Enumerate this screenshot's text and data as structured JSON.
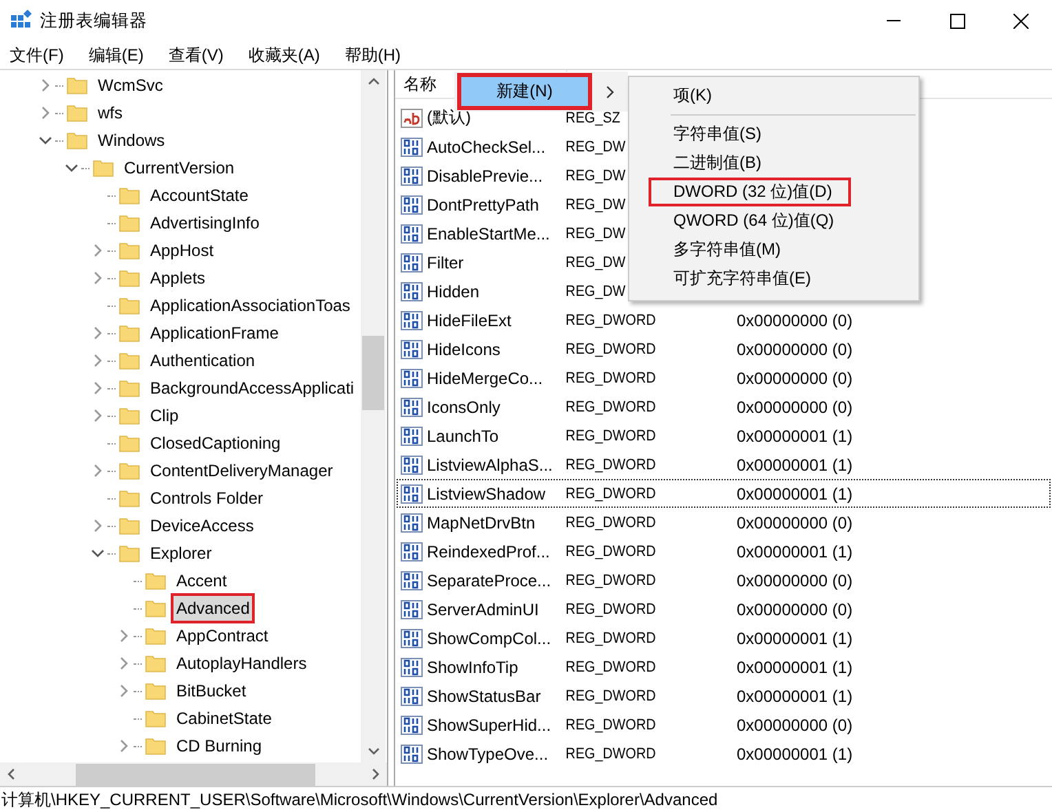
{
  "window": {
    "title": "注册表编辑器"
  },
  "menu_bar": [
    "文件(F)",
    "编辑(E)",
    "查看(V)",
    "收藏夹(A)",
    "帮助(H)"
  ],
  "tree": [
    {
      "label": "WcmSvc",
      "kind": "collapsed",
      "selected": false,
      "highlighted": false
    },
    {
      "label": "wfs",
      "kind": "collapsed",
      "selected": false,
      "highlighted": false
    },
    {
      "label": "Windows",
      "kind": "expanded",
      "selected": false,
      "highlighted": false,
      "children": [
        {
          "label": "CurrentVersion",
          "kind": "expanded",
          "selected": false,
          "highlighted": false,
          "children": [
            {
              "label": "AccountState",
              "kind": "leaf",
              "selected": false,
              "highlighted": false
            },
            {
              "label": "AdvertisingInfo",
              "kind": "leaf",
              "selected": false,
              "highlighted": false
            },
            {
              "label": "AppHost",
              "kind": "collapsed",
              "selected": false,
              "highlighted": false
            },
            {
              "label": "Applets",
              "kind": "collapsed",
              "selected": false,
              "highlighted": false
            },
            {
              "label": "ApplicationAssociationToas",
              "kind": "leaf",
              "selected": false,
              "highlighted": false
            },
            {
              "label": "ApplicationFrame",
              "kind": "collapsed",
              "selected": false,
              "highlighted": false
            },
            {
              "label": "Authentication",
              "kind": "collapsed",
              "selected": false,
              "highlighted": false
            },
            {
              "label": "BackgroundAccessApplicati",
              "kind": "collapsed",
              "selected": false,
              "highlighted": false
            },
            {
              "label": "Clip",
              "kind": "collapsed",
              "selected": false,
              "highlighted": false
            },
            {
              "label": "ClosedCaptioning",
              "kind": "leaf",
              "selected": false,
              "highlighted": false
            },
            {
              "label": "ContentDeliveryManager",
              "kind": "collapsed",
              "selected": false,
              "highlighted": false
            },
            {
              "label": "Controls Folder",
              "kind": "leaf",
              "selected": false,
              "highlighted": false
            },
            {
              "label": "DeviceAccess",
              "kind": "collapsed",
              "selected": false,
              "highlighted": false
            },
            {
              "label": "Explorer",
              "kind": "expanded",
              "selected": false,
              "highlighted": false,
              "children": [
                {
                  "label": "Accent",
                  "kind": "leaf",
                  "selected": false,
                  "highlighted": false
                },
                {
                  "label": "Advanced",
                  "kind": "leaf",
                  "selected": true,
                  "highlighted": true
                },
                {
                  "label": "AppContract",
                  "kind": "collapsed",
                  "selected": false,
                  "highlighted": false
                },
                {
                  "label": "AutoplayHandlers",
                  "kind": "collapsed",
                  "selected": false,
                  "highlighted": false
                },
                {
                  "label": "BitBucket",
                  "kind": "collapsed",
                  "selected": false,
                  "highlighted": false
                },
                {
                  "label": "CabinetState",
                  "kind": "leaf",
                  "selected": false,
                  "highlighted": false
                },
                {
                  "label": "CD Burning",
                  "kind": "collapsed",
                  "selected": false,
                  "highlighted": false
                }
              ]
            }
          ]
        }
      ]
    }
  ],
  "list": {
    "column_1": "名称",
    "rows": [
      {
        "kind": "string",
        "name": "(默认)",
        "type": "REG_SZ",
        "focused": false
      },
      {
        "kind": "dword",
        "name": "AutoCheckSel...",
        "type": "REG_DW",
        "focused": false
      },
      {
        "kind": "dword",
        "name": "DisablePrevie...",
        "type": "REG_DW",
        "focused": false
      },
      {
        "kind": "dword",
        "name": "DontPrettyPath",
        "type": "REG_DW",
        "focused": false
      },
      {
        "kind": "dword",
        "name": "EnableStartMe...",
        "type": "REG_DW",
        "focused": false
      },
      {
        "kind": "dword",
        "name": "Filter",
        "type": "REG_DW",
        "focused": false
      },
      {
        "kind": "dword",
        "name": "Hidden",
        "type": "REG_DW",
        "focused": false
      },
      {
        "kind": "dword",
        "name": "HideFileExt",
        "type": "REG_DWORD",
        "data": "0x00000000 (0)",
        "focused": false
      },
      {
        "kind": "dword",
        "name": "HideIcons",
        "type": "REG_DWORD",
        "data": "0x00000000 (0)",
        "focused": false
      },
      {
        "kind": "dword",
        "name": "HideMergeCo...",
        "type": "REG_DWORD",
        "data": "0x00000000 (0)",
        "focused": false
      },
      {
        "kind": "dword",
        "name": "IconsOnly",
        "type": "REG_DWORD",
        "data": "0x00000000 (0)",
        "focused": false
      },
      {
        "kind": "dword",
        "name": "LaunchTo",
        "type": "REG_DWORD",
        "data": "0x00000001 (1)",
        "focused": false
      },
      {
        "kind": "dword",
        "name": "ListviewAlphaS...",
        "type": "REG_DWORD",
        "data": "0x00000001 (1)",
        "focused": false
      },
      {
        "kind": "dword",
        "name": "ListviewShadow",
        "type": "REG_DWORD",
        "data": "0x00000001 (1)",
        "focused": true
      },
      {
        "kind": "dword",
        "name": "MapNetDrvBtn",
        "type": "REG_DWORD",
        "data": "0x00000000 (0)",
        "focused": false
      },
      {
        "kind": "dword",
        "name": "ReindexedProf...",
        "type": "REG_DWORD",
        "data": "0x00000001 (1)",
        "focused": false
      },
      {
        "kind": "dword",
        "name": "SeparateProce...",
        "type": "REG_DWORD",
        "data": "0x00000000 (0)",
        "focused": false
      },
      {
        "kind": "dword",
        "name": "ServerAdminUI",
        "type": "REG_DWORD",
        "data": "0x00000000 (0)",
        "focused": false
      },
      {
        "kind": "dword",
        "name": "ShowCompCol...",
        "type": "REG_DWORD",
        "data": "0x00000001 (1)",
        "focused": false
      },
      {
        "kind": "dword",
        "name": "ShowInfoTip",
        "type": "REG_DWORD",
        "data": "0x00000001 (1)",
        "focused": false
      },
      {
        "kind": "dword",
        "name": "ShowStatusBar",
        "type": "REG_DWORD",
        "data": "0x00000001 (1)",
        "focused": false
      },
      {
        "kind": "dword",
        "name": "ShowSuperHid...",
        "type": "REG_DWORD",
        "data": "0x00000000 (0)",
        "focused": false
      },
      {
        "kind": "dword",
        "name": "ShowTypeOve...",
        "type": "REG_DWORD",
        "data": "0x00000001 (1)",
        "focused": false
      }
    ]
  },
  "context_menu": {
    "label": "新建(N)",
    "selected": true,
    "highlighted": true
  },
  "submenu": [
    {
      "label": "项(K)",
      "highlighted": false,
      "separator_after": true
    },
    {
      "label": "字符串值(S)",
      "highlighted": false,
      "separator_after": false
    },
    {
      "label": "二进制值(B)",
      "highlighted": false,
      "separator_after": false
    },
    {
      "label": "DWORD (32 位)值(D)",
      "highlighted": true,
      "separator_after": false
    },
    {
      "label": "QWORD (64 位)值(Q)",
      "highlighted": false,
      "separator_after": false
    },
    {
      "label": "多字符串值(M)",
      "highlighted": false,
      "separator_after": false
    },
    {
      "label": "可扩充字符串值(E)",
      "highlighted": false,
      "separator_after": false
    }
  ],
  "status_bar": "计算机\\HKEY_CURRENT_USER\\Software\\Microsoft\\Windows\\CurrentVersion\\Explorer\\Advanced"
}
